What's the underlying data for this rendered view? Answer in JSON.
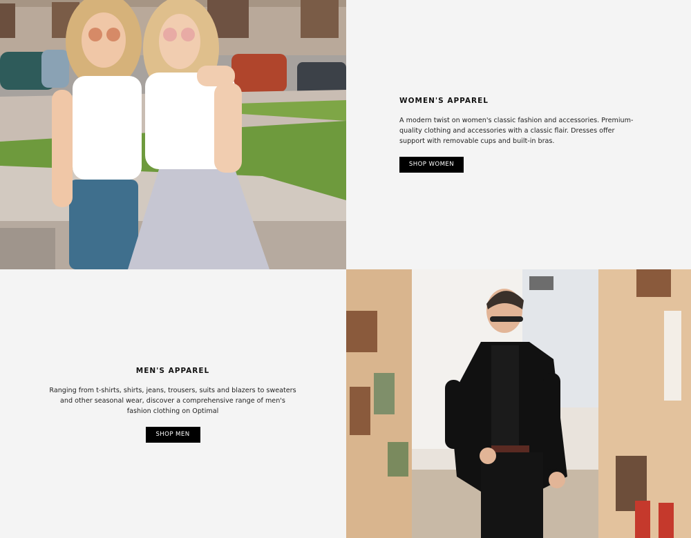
{
  "women": {
    "title": "WOMEN'S APPAREL",
    "description": "A modern twist on women's classic fashion and accessories. Premium-quality clothing and accessories with a classic flair. Dresses offer support with removable cups and built-in bras.",
    "button_label": "SHOP WOMEN",
    "image": "two-women-friends-photo"
  },
  "men": {
    "title": "MEN'S APPAREL",
    "description": "Ranging from t-shirts, shirts, jeans, trousers, suits and blazers to sweaters and other seasonal wear, discover a comprehensive range of men's fashion clothing on Optimal",
    "button_label": "SHOP MEN",
    "image": "man-in-black-jacket-photo"
  },
  "colors": {
    "background": "#f4f4f4",
    "button_bg": "#000000",
    "button_text": "#ffffff"
  }
}
